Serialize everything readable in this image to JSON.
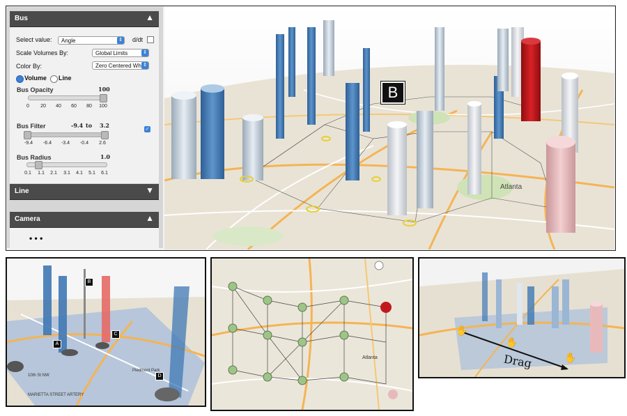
{
  "panels": {
    "bus": {
      "title": "Bus",
      "select_value_label": "Select value:",
      "select_value": "Angle",
      "ddt_label": "d/dt",
      "scale_label": "Scale Volumes By:",
      "scale_value": "Global Limits",
      "color_label": "Color By:",
      "color_value": "Zero Centered White",
      "radio_volume": "Volume",
      "radio_line": "Line",
      "opacity_label": "Bus Opacity",
      "opacity_value": "100",
      "opacity_ticks": [
        "0",
        "20",
        "40",
        "60",
        "80",
        "100"
      ],
      "filter_label": "Bus Filter",
      "filter_min": "-9.4",
      "filter_to": "to",
      "filter_max": "3.2",
      "filter_ticks": [
        "-9.4",
        "-6.4",
        "-3.4",
        "-0.4",
        "2.6"
      ],
      "radius_label": "Bus Radius",
      "radius_value": "1.0",
      "radius_ticks": [
        "0.1",
        "1.1",
        "2.1",
        "3.1",
        "4.1",
        "5.1",
        "6.1"
      ]
    },
    "line": {
      "title": "Line"
    },
    "camera": {
      "title": "Camera",
      "ellipsis": "• • •"
    }
  },
  "labels": {
    "a": "A",
    "b": "B",
    "atlanta": "Atlanta",
    "bottom_left_markers": [
      "A",
      "B",
      "C",
      "D"
    ],
    "drag": "Drag",
    "map_text": [
      "Piedmont Park",
      "MARIETTA STREET ARTERY",
      "10th St NW"
    ]
  },
  "colors": {
    "panel_header": "#4a4a4a",
    "accent_blue": "#3b82d8",
    "cylinder_blue": "#3f78b5",
    "cylinder_grey": "#c9d3dd",
    "cylinder_red": "#c0161b",
    "cylinder_pink": "#e8b9bb"
  }
}
